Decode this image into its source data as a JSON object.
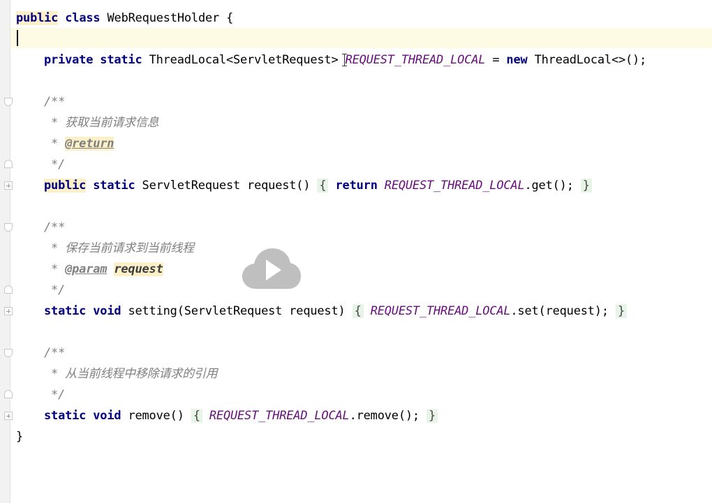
{
  "editor": {
    "class_decl": {
      "kw1": "public",
      "kw2": "class",
      "name": "WebRequestHolder",
      "brace": "{"
    },
    "field_decl": {
      "kw1": "private",
      "kw2": "static",
      "type": "ThreadLocal<ServletRequest>",
      "name": "REQUEST_THREAD_LOCAL",
      "eq": "=",
      "kw_new": "new",
      "init": "ThreadLocal<>();"
    },
    "doc1": {
      "open": "/**",
      "text": "* 获取当前请求信息",
      "star": "*",
      "tag": "@return",
      "close": "*/"
    },
    "method1": {
      "kw1": "public",
      "kw2": "static",
      "sig": "ServletRequest request()",
      "lbrace": "{",
      "kw_return": "return",
      "field": "REQUEST_THREAD_LOCAL",
      "call": ".get();",
      "rbrace": "}"
    },
    "doc2": {
      "open": "/**",
      "text": "* 保存当前请求到当前线程",
      "star": "*",
      "tag": "@param",
      "param": "request",
      "close": "*/"
    },
    "method2": {
      "kw1": "static",
      "kw2": "void",
      "sig": "setting(ServletRequest request)",
      "lbrace": "{",
      "field": "REQUEST_THREAD_LOCAL",
      "call": ".set(request);",
      "rbrace": "}"
    },
    "doc3": {
      "open": "/**",
      "text": "* 从当前线程中移除请求的引用",
      "close": "*/"
    },
    "method3": {
      "kw1": "static",
      "kw2": "void",
      "sig": "remove()",
      "lbrace": "{",
      "field": "REQUEST_THREAD_LOCAL",
      "call": ".remove();",
      "rbrace": "}"
    },
    "class_close": "}"
  },
  "colors": {
    "keyword": "#000080",
    "field": "#660e7a",
    "doc_comment": "#808080",
    "current_line": "#fefbe4",
    "usage_highlight": "#fbf0c8",
    "folded_region": "#e8f4e8"
  },
  "overlay": {
    "icon": "play-icon"
  }
}
